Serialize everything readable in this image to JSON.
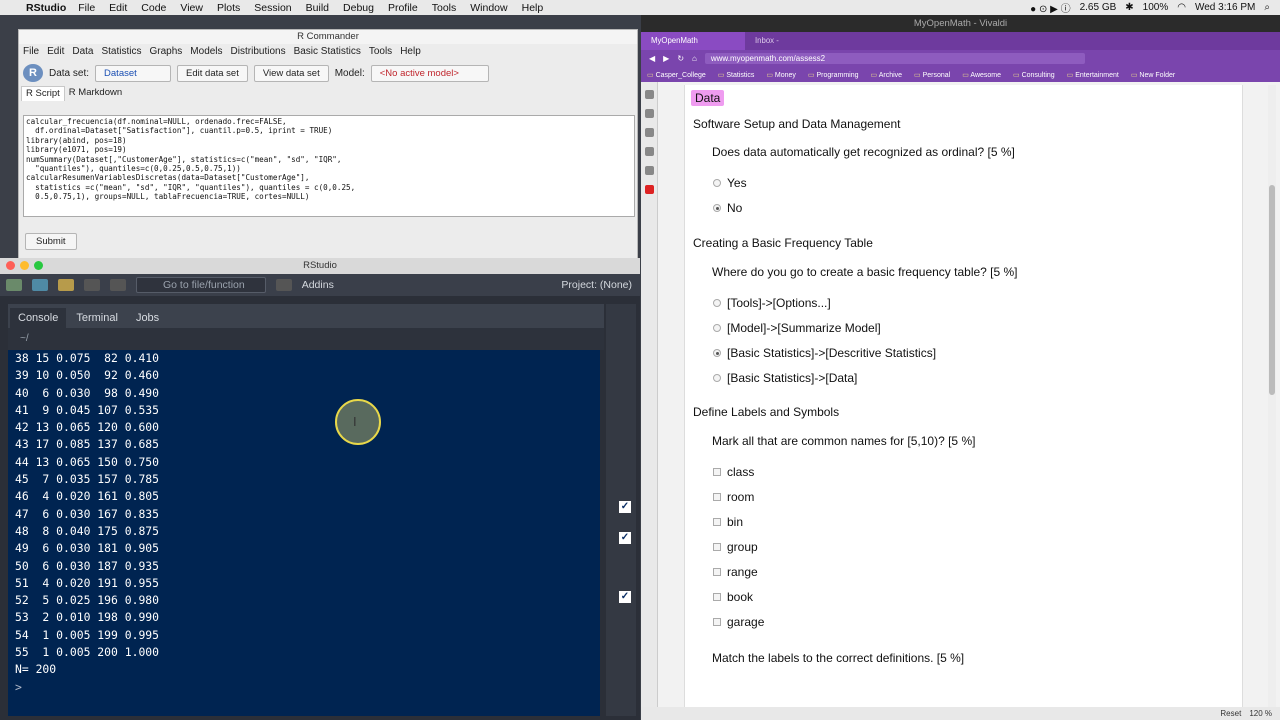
{
  "menubar": {
    "app": "RStudio",
    "items": [
      "File",
      "Edit",
      "Code",
      "View",
      "Plots",
      "Session",
      "Build",
      "Debug",
      "Profile",
      "Tools",
      "Window",
      "Help"
    ],
    "cpu": "2.65 GB",
    "battery": "100%",
    "clock": "Wed 3:16 PM"
  },
  "rcommander": {
    "title": "R Commander",
    "menu": [
      "File",
      "Edit",
      "Data",
      "Statistics",
      "Graphs",
      "Models",
      "Distributions",
      "Basic Statistics",
      "Tools",
      "Help"
    ],
    "dataset_label": "Data set:",
    "dataset_value": "Dataset",
    "edit_btn": "Edit data set",
    "view_btn": "View data set",
    "model_label": "Model:",
    "model_value": "<No active model>",
    "tab_script": "R Script",
    "tab_markdown": "R Markdown",
    "script": "calcular_frecuencia(df.nominal=NULL, ordenado.frec=FALSE,\n  df.ordinal=Dataset[\"Satisfaction\"], cuantil.p=0.5, iprint = TRUE)\nlibrary(abind, pos=18)\nlibrary(e1071, pos=19)\nnumSummary(Dataset[,\"CustomerAge\"], statistics=c(\"mean\", \"sd\", \"IQR\",\n  \"quantiles\"), quantiles=c(0,0.25,0.5,0.75,1))\ncalcularResumenVariablesDiscretas(data=Dataset[\"CustomerAge\"],\n  statistics =c(\"mean\", \"sd\", \"IQR\", \"quantiles\"), quantiles = c(0,0.25,\n  0.5,0.75,1), groups=NULL, tablaFrecuencia=TRUE, cortes=NULL)",
    "submit": "Submit"
  },
  "rstudio": {
    "title": "RStudio",
    "goto": "Go to file/function",
    "addins": "Addins",
    "project": "Project: (None)",
    "tabs": [
      "Console",
      "Terminal",
      "Jobs"
    ],
    "path": "~/",
    "console_lines": [
      "38 15 0.075  82 0.410",
      "39 10 0.050  92 0.460",
      "40  6 0.030  98 0.490",
      "41  9 0.045 107 0.535",
      "42 13 0.065 120 0.600",
      "43 17 0.085 137 0.685",
      "44 13 0.065 150 0.750",
      "45  7 0.035 157 0.785",
      "46  4 0.020 161 0.805",
      "47  6 0.030 167 0.835",
      "48  8 0.040 175 0.875",
      "49  6 0.030 181 0.905",
      "50  6 0.030 187 0.935",
      "51  4 0.020 191 0.955",
      "52  5 0.025 196 0.980",
      "53  2 0.010 198 0.990",
      "54  1 0.005 199 0.995",
      "55  1 0.005 200 1.000",
      "N= 200"
    ],
    "prompt": ">"
  },
  "browser": {
    "title": "MyOpenMath - Vivaldi",
    "tabs": [
      "MyOpenMath",
      "Inbox - ethan.harris@casp..."
    ],
    "url": "www.myopenmath.com/assess2",
    "bookmarks": [
      "Casper_College",
      "Statistics",
      "Money",
      "Programming",
      "Archive",
      "Personal",
      "Awesome",
      "Consulting",
      "Entertainment",
      "New Folder"
    ],
    "reset": "Reset",
    "zoom": "120 %"
  },
  "quiz": {
    "badge": "Data",
    "sections": [
      {
        "title": "Software Setup and Data Management",
        "question": "Does data automatically get recognized as ordinal? [5 %]",
        "options": [
          {
            "label": "Yes",
            "selected": false
          },
          {
            "label": "No",
            "selected": true
          }
        ]
      },
      {
        "title": "Creating a Basic Frequency Table",
        "question": "Where do you go to create a basic frequency table? [5 %]",
        "options": [
          {
            "label": "[Tools]->[Options...]",
            "selected": false
          },
          {
            "label": "[Model]->[Summarize Model]",
            "selected": false
          },
          {
            "label": "[Basic Statistics]->[Descritive Statistics]",
            "selected": true
          },
          {
            "label": "[Basic Statistics]->[Data]",
            "selected": false
          }
        ]
      },
      {
        "title": "Define Labels and Symbols",
        "question": "Mark all that are common names for [5,10)? [5 %]",
        "options": [
          {
            "label": "class"
          },
          {
            "label": "room"
          },
          {
            "label": "bin"
          },
          {
            "label": "group"
          },
          {
            "label": "range"
          },
          {
            "label": "book"
          },
          {
            "label": "garage"
          }
        ]
      }
    ],
    "match_question": "Match the labels to the correct definitions. [5 %]"
  }
}
